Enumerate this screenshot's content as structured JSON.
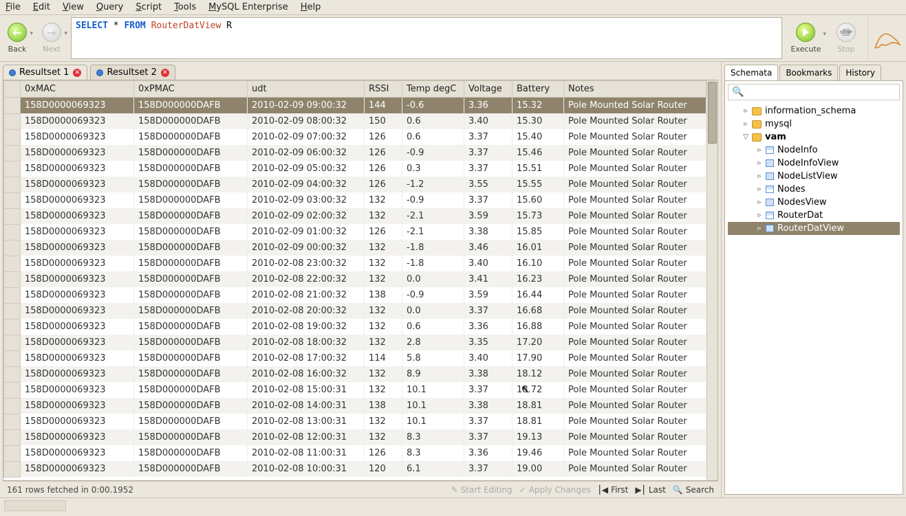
{
  "menu": {
    "items": [
      "File",
      "Edit",
      "View",
      "Query",
      "Script",
      "Tools",
      "MySQL Enterprise",
      "Help"
    ]
  },
  "toolbar": {
    "back": "Back",
    "next": "Next",
    "execute": "Execute",
    "stop": "Stop"
  },
  "sql": {
    "kw1": "SELECT",
    "star": " * ",
    "kw2": "FROM",
    "id": " RouterDatView ",
    "alias": "R"
  },
  "result_tabs": {
    "t1": "Resultset 1",
    "t2": "Resultset 2"
  },
  "columns": [
    "0xMAC",
    "0xPMAC",
    "udt",
    "RSSI",
    "Temp degC",
    "Voltage",
    "Battery",
    "Notes"
  ],
  "rows": [
    [
      "158D0000069323",
      "158D000000DAFB",
      "2010-02-09 09:00:32",
      "144",
      "-0.6",
      "3.36",
      "15.32",
      "Pole Mounted Solar Router"
    ],
    [
      "158D0000069323",
      "158D000000DAFB",
      "2010-02-09 08:00:32",
      "150",
      "0.6",
      "3.40",
      "15.30",
      "Pole Mounted Solar Router"
    ],
    [
      "158D0000069323",
      "158D000000DAFB",
      "2010-02-09 07:00:32",
      "126",
      "0.6",
      "3.37",
      "15.40",
      "Pole Mounted Solar Router"
    ],
    [
      "158D0000069323",
      "158D000000DAFB",
      "2010-02-09 06:00:32",
      "126",
      "-0.9",
      "3.37",
      "15.46",
      "Pole Mounted Solar Router"
    ],
    [
      "158D0000069323",
      "158D000000DAFB",
      "2010-02-09 05:00:32",
      "126",
      "0.3",
      "3.37",
      "15.51",
      "Pole Mounted Solar Router"
    ],
    [
      "158D0000069323",
      "158D000000DAFB",
      "2010-02-09 04:00:32",
      "126",
      "-1.2",
      "3.55",
      "15.55",
      "Pole Mounted Solar Router"
    ],
    [
      "158D0000069323",
      "158D000000DAFB",
      "2010-02-09 03:00:32",
      "132",
      "-0.9",
      "3.37",
      "15.60",
      "Pole Mounted Solar Router"
    ],
    [
      "158D0000069323",
      "158D000000DAFB",
      "2010-02-09 02:00:32",
      "132",
      "-2.1",
      "3.59",
      "15.73",
      "Pole Mounted Solar Router"
    ],
    [
      "158D0000069323",
      "158D000000DAFB",
      "2010-02-09 01:00:32",
      "126",
      "-2.1",
      "3.38",
      "15.85",
      "Pole Mounted Solar Router"
    ],
    [
      "158D0000069323",
      "158D000000DAFB",
      "2010-02-09 00:00:32",
      "132",
      "-1.8",
      "3.46",
      "16.01",
      "Pole Mounted Solar Router"
    ],
    [
      "158D0000069323",
      "158D000000DAFB",
      "2010-02-08 23:00:32",
      "132",
      "-1.8",
      "3.40",
      "16.10",
      "Pole Mounted Solar Router"
    ],
    [
      "158D0000069323",
      "158D000000DAFB",
      "2010-02-08 22:00:32",
      "132",
      "0.0",
      "3.41",
      "16.23",
      "Pole Mounted Solar Router"
    ],
    [
      "158D0000069323",
      "158D000000DAFB",
      "2010-02-08 21:00:32",
      "138",
      "-0.9",
      "3.59",
      "16.44",
      "Pole Mounted Solar Router"
    ],
    [
      "158D0000069323",
      "158D000000DAFB",
      "2010-02-08 20:00:32",
      "132",
      "0.0",
      "3.37",
      "16.68",
      "Pole Mounted Solar Router"
    ],
    [
      "158D0000069323",
      "158D000000DAFB",
      "2010-02-08 19:00:32",
      "132",
      "0.6",
      "3.36",
      "16.88",
      "Pole Mounted Solar Router"
    ],
    [
      "158D0000069323",
      "158D000000DAFB",
      "2010-02-08 18:00:32",
      "132",
      "2.8",
      "3.35",
      "17.20",
      "Pole Mounted Solar Router"
    ],
    [
      "158D0000069323",
      "158D000000DAFB",
      "2010-02-08 17:00:32",
      "114",
      "5.8",
      "3.40",
      "17.90",
      "Pole Mounted Solar Router"
    ],
    [
      "158D0000069323",
      "158D000000DAFB",
      "2010-02-08 16:00:32",
      "132",
      "8.9",
      "3.38",
      "18.12",
      "Pole Mounted Solar Router"
    ],
    [
      "158D0000069323",
      "158D000000DAFB",
      "2010-02-08 15:00:31",
      "132",
      "10.1",
      "3.37",
      "18.72",
      "Pole Mounted Solar Router"
    ],
    [
      "158D0000069323",
      "158D000000DAFB",
      "2010-02-08 14:00:31",
      "138",
      "10.1",
      "3.38",
      "18.81",
      "Pole Mounted Solar Router"
    ],
    [
      "158D0000069323",
      "158D000000DAFB",
      "2010-02-08 13:00:31",
      "132",
      "10.1",
      "3.37",
      "18.81",
      "Pole Mounted Solar Router"
    ],
    [
      "158D0000069323",
      "158D000000DAFB",
      "2010-02-08 12:00:31",
      "132",
      "8.3",
      "3.37",
      "19.13",
      "Pole Mounted Solar Router"
    ],
    [
      "158D0000069323",
      "158D000000DAFB",
      "2010-02-08 11:00:31",
      "126",
      "8.3",
      "3.36",
      "19.46",
      "Pole Mounted Solar Router"
    ],
    [
      "158D0000069323",
      "158D000000DAFB",
      "2010-02-08 10:00:31",
      "120",
      "6.1",
      "3.37",
      "19.00",
      "Pole Mounted Solar Router"
    ]
  ],
  "status": "161 rows fetched in 0:00.1952",
  "actions": {
    "start_edit": "Start Editing",
    "apply": "Apply Changes",
    "first": "First",
    "last": "Last",
    "search": "Search"
  },
  "right": {
    "tabs": {
      "schemata": "Schemata",
      "bookmarks": "Bookmarks",
      "history": "History"
    },
    "nodes": {
      "info_schema": "information_schema",
      "mysql": "mysql",
      "vam": "vam",
      "NodeInfo": "NodeInfo",
      "NodeInfoView": "NodeInfoView",
      "NodeListView": "NodeListView",
      "Nodes": "Nodes",
      "NodesView": "NodesView",
      "RouterDat": "RouterDat",
      "RouterDatView": "RouterDatView"
    }
  }
}
